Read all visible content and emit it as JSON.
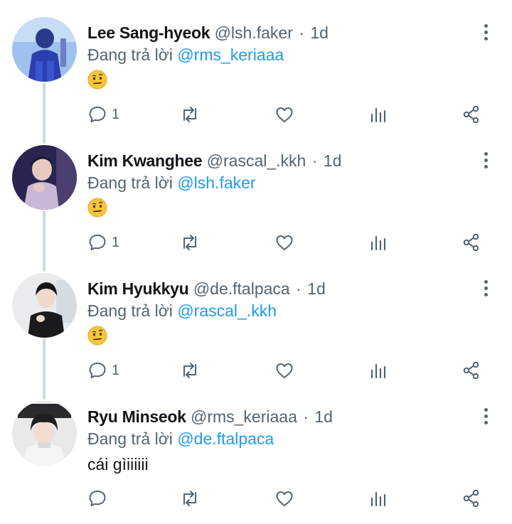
{
  "tweets": [
    {
      "name": "Lee Sang-hyeok",
      "handle": "@lsh.faker",
      "separator": "·",
      "time": "1d",
      "reply_prefix": "Đang trả lời",
      "reply_to": "@rms_keriaaa",
      "text": "",
      "emoji": "face-with-raised-eyebrow-emoji",
      "reply_count": "1",
      "avatar_colors": [
        "#2c3fb0",
        "#9fc1ef"
      ]
    },
    {
      "name": "Kim Kwanghee",
      "handle": "@rascal_.kkh",
      "separator": "·",
      "time": "1d",
      "reply_prefix": "Đang trả lời",
      "reply_to": "@lsh.faker",
      "text": "",
      "emoji": "face-with-raised-eyebrow-emoji",
      "reply_count": "1",
      "avatar_colors": [
        "#2a2550",
        "#c9b7d8"
      ]
    },
    {
      "name": "Kim Hyukkyu",
      "handle": "@de.ftalpaca",
      "separator": "·",
      "time": "1d",
      "reply_prefix": "Đang trả lời",
      "reply_to": "@rascal_.kkh",
      "text": "",
      "emoji": "face-with-raised-eyebrow-emoji",
      "reply_count": "1",
      "avatar_colors": [
        "#e8ecef",
        "#1b1b1d"
      ]
    },
    {
      "name": "Ryu Minseok",
      "handle": "@rms_keriaaa",
      "separator": "·",
      "time": "1d",
      "reply_prefix": "Đang trả lời",
      "reply_to": "@de.ftalpaca",
      "text": "cái gìiiiiii",
      "emoji": "",
      "reply_count": "",
      "avatar_colors": [
        "#e9e9ea",
        "#1f1f22"
      ]
    }
  ],
  "icons": {
    "reply": "reply-icon",
    "retweet": "retweet-icon",
    "like": "heart-icon",
    "views": "views-icon",
    "share": "share-icon",
    "more": "more-vertical-icon"
  },
  "colors": {
    "text": "#0f1419",
    "secondary": "#536471",
    "link": "#1d9bf0",
    "thread_line": "#cfd9de"
  }
}
